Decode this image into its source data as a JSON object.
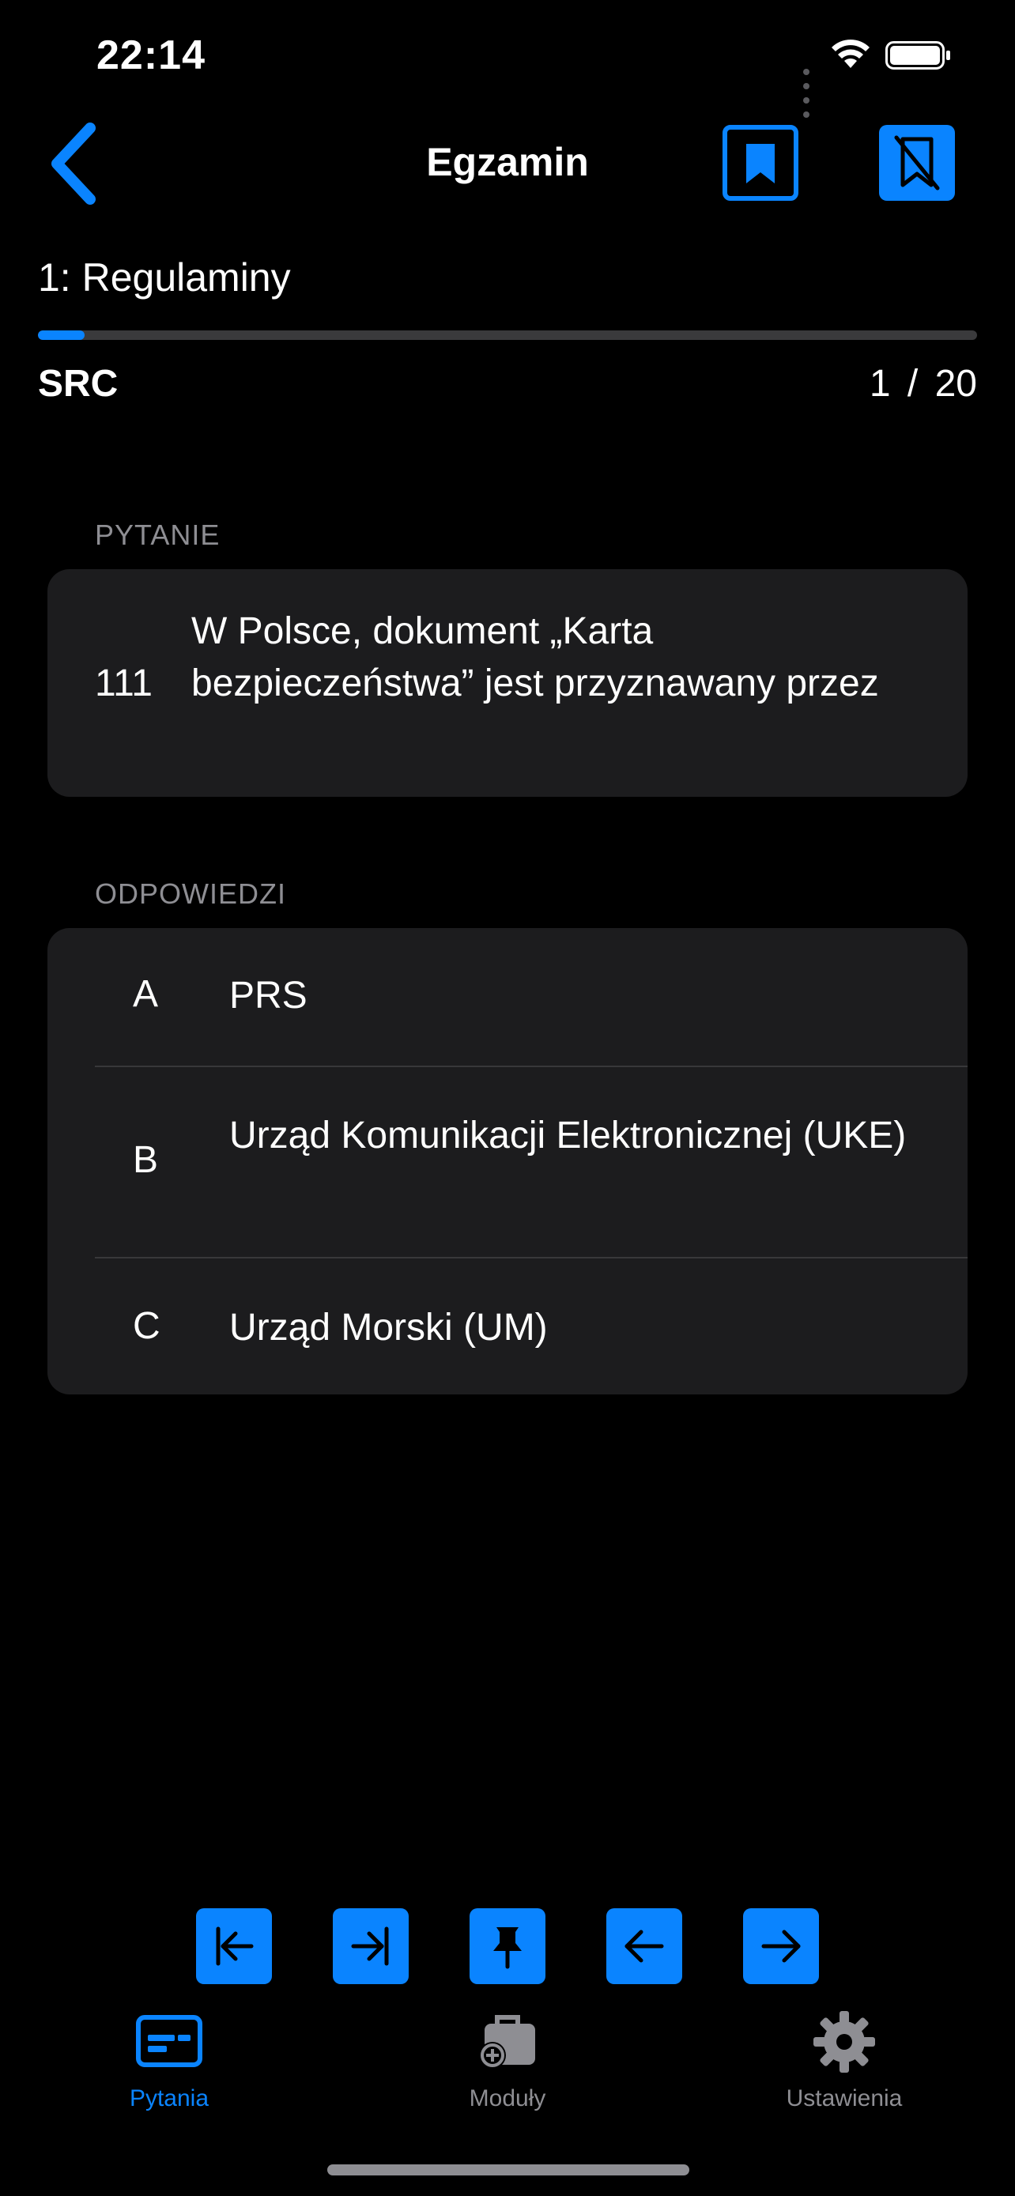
{
  "status_bar": {
    "time": "22:14",
    "icons": [
      "signal-dots-icon",
      "wifi-icon",
      "battery-icon"
    ]
  },
  "nav": {
    "back_icon": "chevron-left-icon",
    "title": "Egzamin",
    "bookmark_icon": "bookmark-icon",
    "unbookmark_icon": "bookmark-slash-icon"
  },
  "section": {
    "title": "1:  Regulaminy",
    "progress": 0.05,
    "category": "SRC",
    "current": "1",
    "separator": "/",
    "total": "20"
  },
  "question": {
    "header": "PYTANIE",
    "number": "111",
    "text": "W Polsce, dokument „Karta bezpieczeństwa” jest przyznawany przez"
  },
  "answers": {
    "header": "ODPOWIEDZI",
    "items": [
      {
        "letter": "A",
        "text": "PRS"
      },
      {
        "letter": "B",
        "text": "Urząd Komunikacji Elektronicznej (UKE)"
      },
      {
        "letter": "C",
        "text": "Urząd Morski (UM)"
      }
    ]
  },
  "controls": [
    "first-question-icon",
    "last-question-icon",
    "pin-icon",
    "previous-arrow-icon",
    "next-arrow-icon"
  ],
  "tabs": [
    {
      "label": "Pytania",
      "icon": "card-icon",
      "active": true
    },
    {
      "label": "Moduły",
      "icon": "briefcase-add-icon",
      "active": false
    },
    {
      "label": "Ustawienia",
      "icon": "gear-icon",
      "active": false
    }
  ],
  "colors": {
    "accent": "#0a84ff",
    "background": "#000000",
    "card": "#1c1c1e",
    "secondary_text": "#8e8e93"
  }
}
